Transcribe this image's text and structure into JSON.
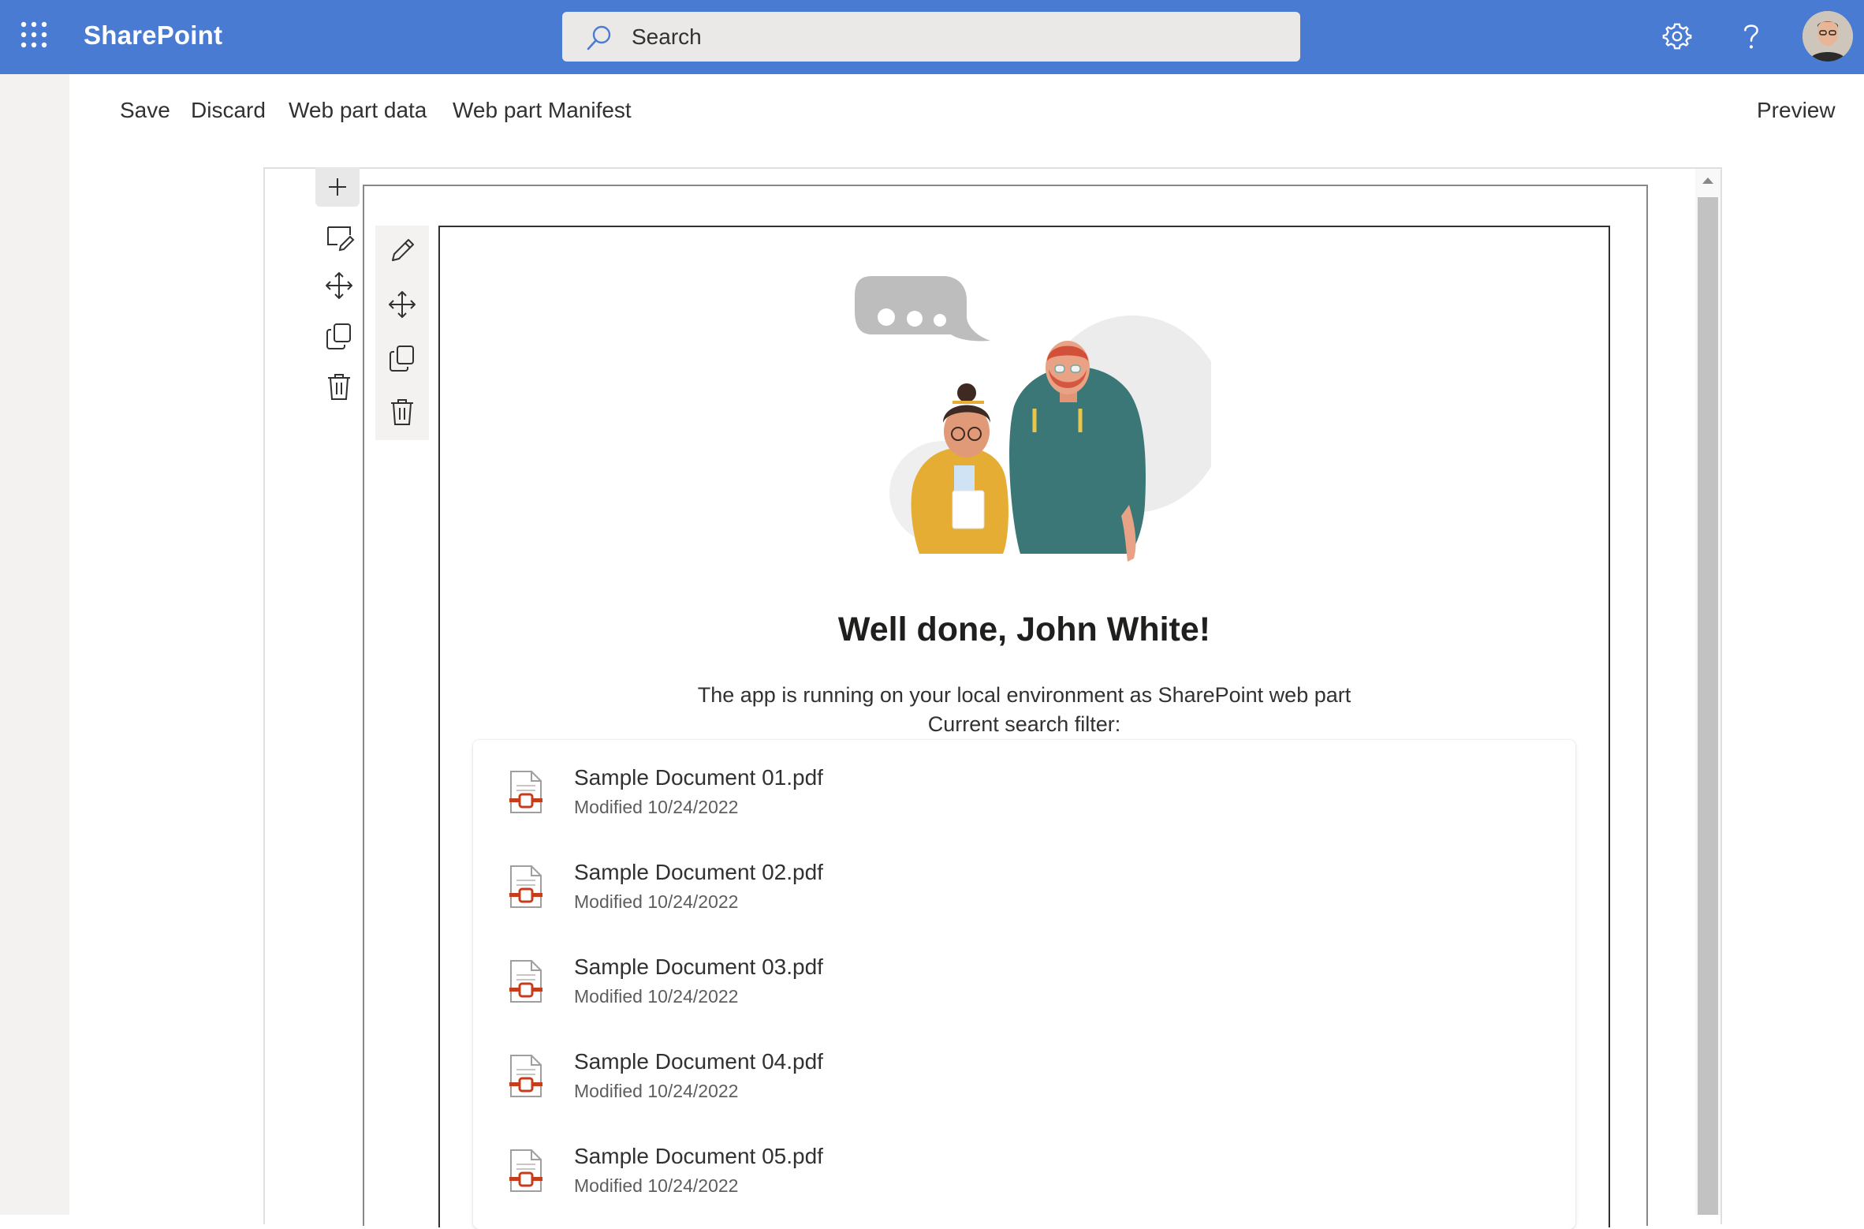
{
  "app": {
    "name": "SharePoint"
  },
  "search": {
    "placeholder": "Search"
  },
  "commands": {
    "save": "Save",
    "discard": "Discard",
    "web_part_data": "Web part data",
    "web_part_manifest": "Web part Manifest",
    "preview": "Preview"
  },
  "webpart": {
    "title": "Well done, John White!",
    "description": "The app is running on your local environment as SharePoint web part",
    "filter_label": "Current search filter:"
  },
  "documents": [
    {
      "name": "Sample Document 01.pdf",
      "modified": "Modified 10/24/2022"
    },
    {
      "name": "Sample Document 02.pdf",
      "modified": "Modified 10/24/2022"
    },
    {
      "name": "Sample Document 03.pdf",
      "modified": "Modified 10/24/2022"
    },
    {
      "name": "Sample Document 04.pdf",
      "modified": "Modified 10/24/2022"
    },
    {
      "name": "Sample Document 05.pdf",
      "modified": "Modified 10/24/2022"
    }
  ],
  "colors": {
    "suite_bar": "#4a7bd2",
    "left_rail": "#f3f2f1",
    "pdf_accent": "#c43e1c"
  },
  "icons": {
    "app_launcher": "waffle-icon",
    "search": "search-icon",
    "settings": "gear-icon",
    "help": "question-icon",
    "section_add": "plus-icon",
    "section_edit": "edit-section-icon",
    "move": "move-icon",
    "duplicate": "duplicate-icon",
    "delete": "trash-icon",
    "webpart_edit": "pencil-icon",
    "document": "pdf-file-icon"
  }
}
